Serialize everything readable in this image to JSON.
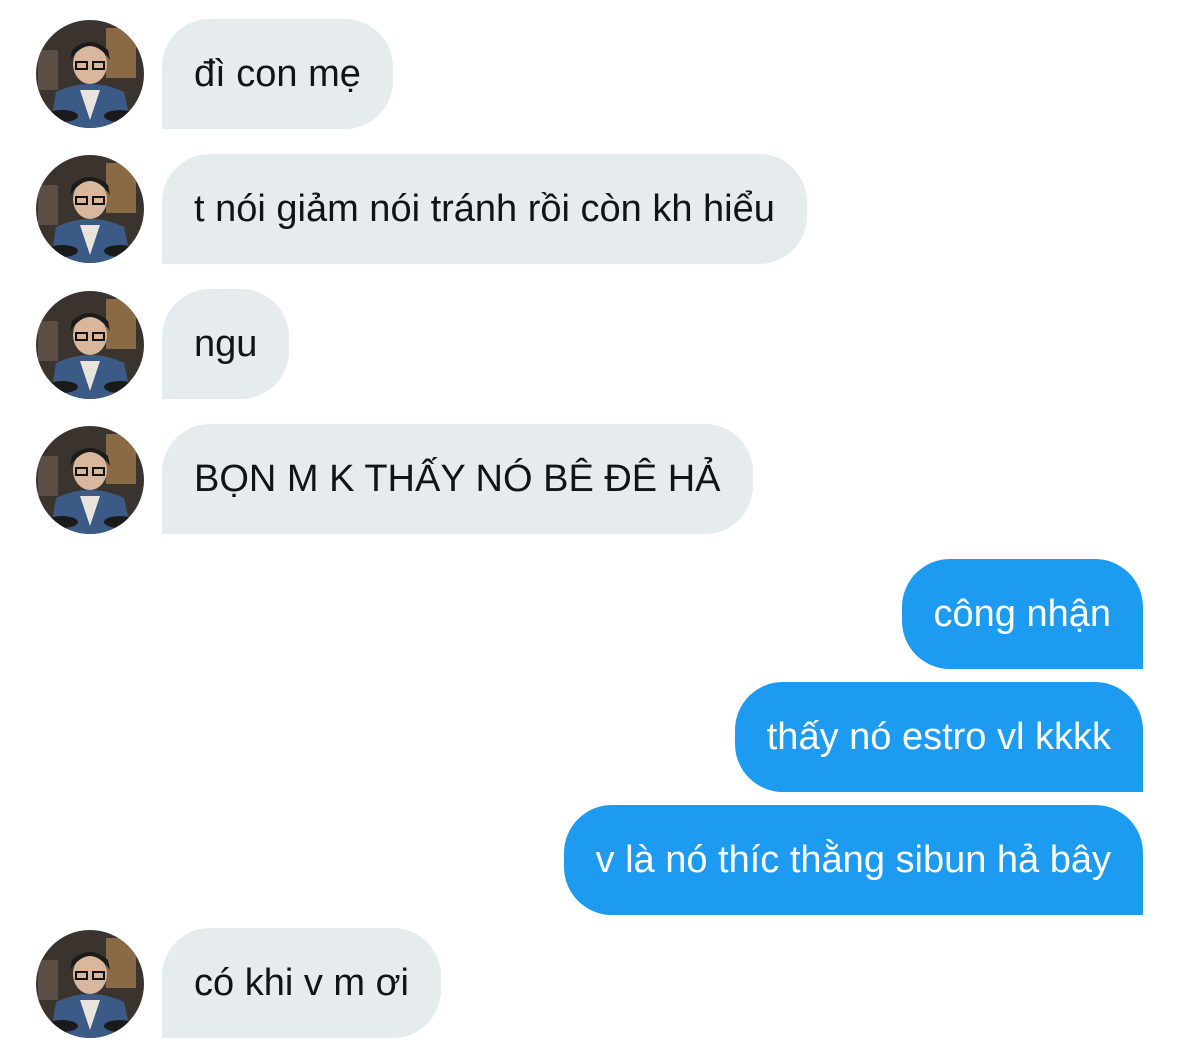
{
  "messages": [
    {
      "direction": "incoming",
      "text": "đì con mẹ",
      "avatar": "user-avatar"
    },
    {
      "direction": "incoming",
      "text": "t nói giảm nói tránh rồi còn kh hiểu",
      "avatar": "user-avatar"
    },
    {
      "direction": "incoming",
      "text": "ngu",
      "avatar": "user-avatar"
    },
    {
      "direction": "incoming",
      "text": "BỌN M K THẤY NÓ BÊ ĐÊ HẢ",
      "avatar": "user-avatar"
    },
    {
      "direction": "outgoing",
      "text": "công nhận"
    },
    {
      "direction": "outgoing",
      "text": "thấy nó estro vl kkkk"
    },
    {
      "direction": "outgoing",
      "text": "v là nó thíc thằng sibun hả bây"
    },
    {
      "direction": "incoming",
      "text": "có khi v m ơi",
      "avatar": "user-avatar"
    }
  ],
  "colors": {
    "incoming_bubble": "#e6ebee",
    "incoming_text": "#0f1419",
    "outgoing_bubble": "#1d9bf0",
    "outgoing_text": "#ffffff"
  }
}
